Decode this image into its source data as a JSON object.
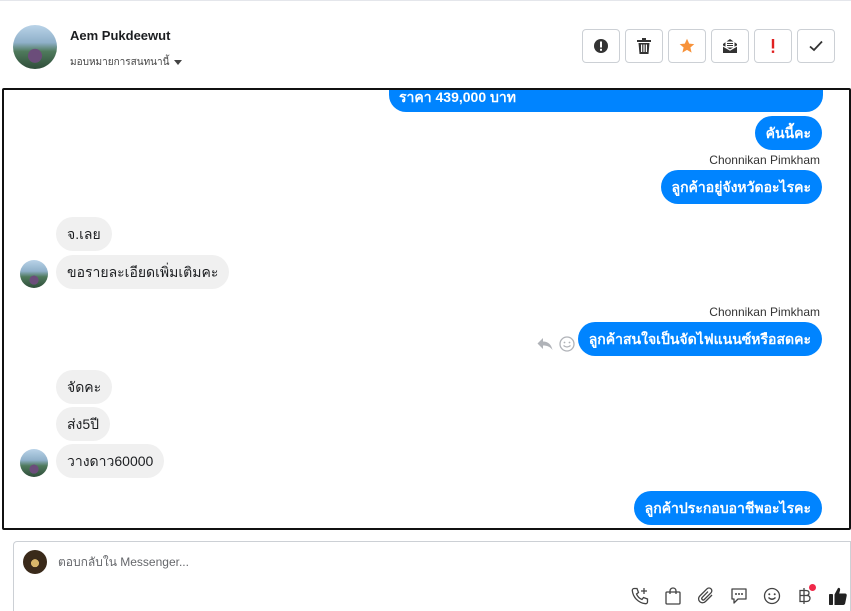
{
  "header": {
    "contact_name": "Aem Pukdeewut",
    "assign_label": "มอบหมายการสนทนานี้",
    "actions": [
      {
        "name": "spam-button",
        "icon": "alert-circle-icon"
      },
      {
        "name": "delete-button",
        "icon": "trash-icon"
      },
      {
        "name": "star-button",
        "icon": "star-icon"
      },
      {
        "name": "mark-unread-button",
        "icon": "envelope-icon"
      },
      {
        "name": "important-button",
        "icon": "exclamation-icon"
      },
      {
        "name": "done-button",
        "icon": "check-icon"
      }
    ]
  },
  "messages": [
    {
      "type": "outgoing",
      "text": "ราคา 439,000 บาท"
    },
    {
      "type": "outgoing",
      "text": "คันนี้คะ"
    },
    {
      "type": "sender",
      "text": "Chonnikan Pimkham"
    },
    {
      "type": "outgoing",
      "text": "ลูกค้าอยู่จังหวัดอะไรคะ"
    },
    {
      "type": "incoming",
      "text": "จ.เลย"
    },
    {
      "type": "incoming",
      "text": "ขอรายละเอียดเพิ่มเติมคะ"
    },
    {
      "type": "sender",
      "text": "Chonnikan Pimkham"
    },
    {
      "type": "outgoing",
      "text": "ลูกค้าสนใจเป็นจัดไฟแนนซ์หรือสดคะ"
    },
    {
      "type": "incoming",
      "text": "จัดคะ"
    },
    {
      "type": "incoming",
      "text": "ส่ง5ปี"
    },
    {
      "type": "incoming",
      "text": "วางดาว60000"
    },
    {
      "type": "outgoing",
      "text": "ลูกค้าประกอบอาชีพอะไรคะ"
    }
  ],
  "composer": {
    "placeholder": "ตอบกลับใน Messenger..."
  },
  "colors": {
    "outgoing_bubble": "#0084ff",
    "incoming_bubble": "#f0f0f0",
    "star": "#f7923a",
    "important": "#e02020",
    "notification_dot": "#f02849"
  }
}
